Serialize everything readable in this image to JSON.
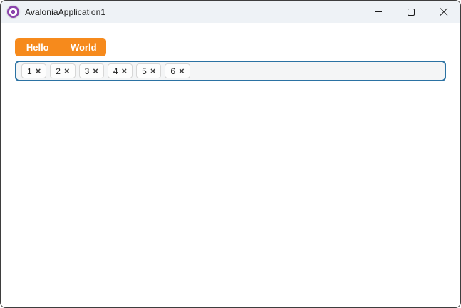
{
  "window": {
    "title": "AvaloniaApplication1"
  },
  "titlebar_icons": {
    "logo": "avalonia-logo",
    "minimize": "minimize-line",
    "maximize": "maximize-square",
    "close": "close-x"
  },
  "toolbar": {
    "buttons": [
      {
        "label": "Hello"
      },
      {
        "label": "World"
      }
    ]
  },
  "tag_box": {
    "chips": [
      {
        "label": "1"
      },
      {
        "label": "2"
      },
      {
        "label": "3"
      },
      {
        "label": "4"
      },
      {
        "label": "5"
      },
      {
        "label": "6"
      }
    ],
    "remove_glyph": "×"
  },
  "colors": {
    "accent_orange": "#F68A1C",
    "focus_border_blue": "#2B72A3",
    "logo_purple": "#8B44AC",
    "titlebar_bg": "#EEF2F6",
    "window_border": "#3E3E3E"
  }
}
